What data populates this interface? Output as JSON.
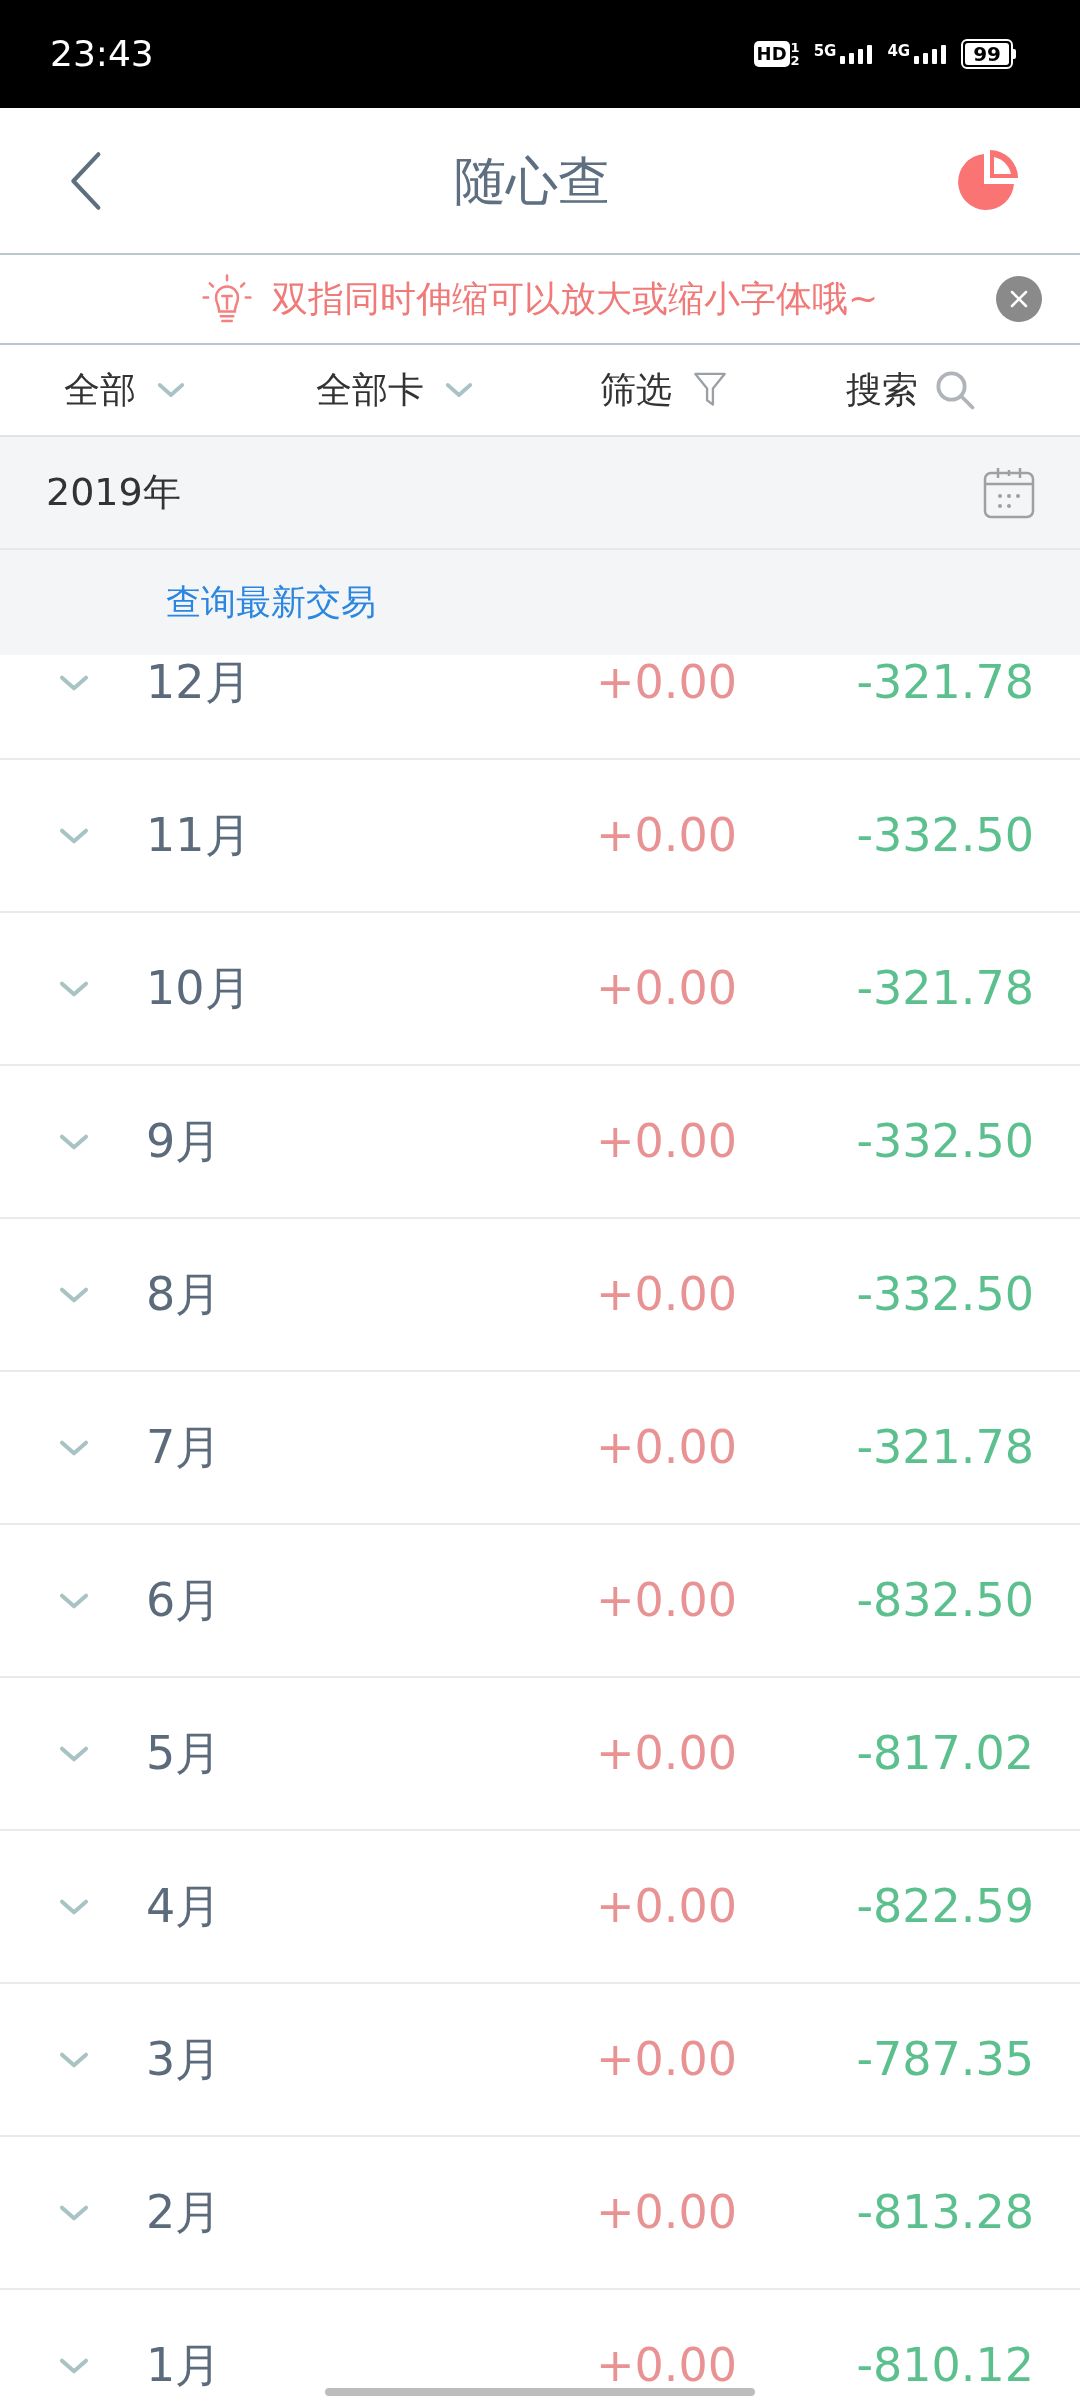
{
  "status_bar": {
    "time": "23:43",
    "hd": "HD",
    "sim_slots": [
      "1",
      "2"
    ],
    "networks": [
      "5G",
      "4G"
    ],
    "battery": "99"
  },
  "header": {
    "title": "随心查"
  },
  "tip": {
    "text": "双指同时伸缩可以放大或缩小字体哦~"
  },
  "filters": [
    {
      "label": "全部",
      "kind": "dropdown"
    },
    {
      "label": "全部卡",
      "kind": "dropdown"
    },
    {
      "label": "筛选",
      "kind": "filter"
    },
    {
      "label": "搜索",
      "kind": "search"
    }
  ],
  "year": {
    "label": "2019年"
  },
  "link": "查询最新交易",
  "months": [
    {
      "month": "12月",
      "income": "+0.00",
      "expense": "-321.78"
    },
    {
      "month": "11月",
      "income": "+0.00",
      "expense": "-332.50"
    },
    {
      "month": "10月",
      "income": "+0.00",
      "expense": "-321.78"
    },
    {
      "month": "9月",
      "income": "+0.00",
      "expense": "-332.50"
    },
    {
      "month": "8月",
      "income": "+0.00",
      "expense": "-332.50"
    },
    {
      "month": "7月",
      "income": "+0.00",
      "expense": "-321.78"
    },
    {
      "month": "6月",
      "income": "+0.00",
      "expense": "-832.50"
    },
    {
      "month": "5月",
      "income": "+0.00",
      "expense": "-817.02"
    },
    {
      "month": "4月",
      "income": "+0.00",
      "expense": "-822.59"
    },
    {
      "month": "3月",
      "income": "+0.00",
      "expense": "-787.35"
    },
    {
      "month": "2月",
      "income": "+0.00",
      "expense": "-813.28"
    },
    {
      "month": "1月",
      "income": "+0.00",
      "expense": "-810.12"
    }
  ]
}
